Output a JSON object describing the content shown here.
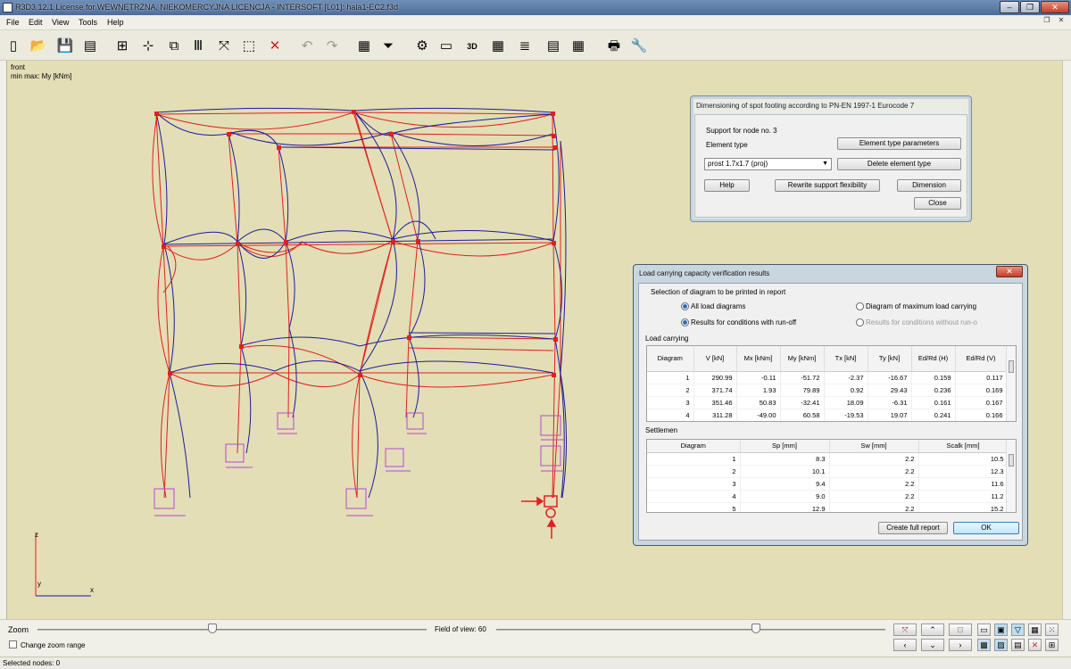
{
  "window": {
    "title": "R3D3 12.1 License for WEWNĘTRZNA, NIEKOMERCYJNA LICENCJA - INTERSOFT [L01]: hala1-EC2.f3d",
    "minimize": "–",
    "maximize": "❐",
    "close": "✕"
  },
  "menu": {
    "items": [
      "File",
      "Edit",
      "View",
      "Tools",
      "Help"
    ]
  },
  "toolbar": {
    "icons": [
      "new-file",
      "open-folder",
      "save",
      "export",
      "frame",
      "node-add",
      "node-move",
      "bars",
      "release",
      "select-area",
      "delete",
      "undo",
      "redo",
      "table",
      "filter",
      "settings-load",
      "view-mode",
      "3d-view",
      "grid",
      "layers",
      "report",
      "calculator",
      "print",
      "tools",
      "help-pointer"
    ],
    "glyphs": [
      "▯",
      "📂",
      "💾",
      "▤",
      "⊞",
      "⊹",
      "⧉",
      "Ⅲ",
      "⤧",
      "⬚",
      "✕",
      "↶",
      "↷",
      "▦",
      "⏷",
      "⚙",
      "▭",
      "3D",
      "▦",
      "≣",
      "▤",
      "▦",
      "🖶",
      "🔧",
      "?"
    ]
  },
  "viewport": {
    "view_name": "front",
    "scale_label": "min max: My [kNm]",
    "axis_z": "z",
    "axis_y": "y",
    "axis_x": "x"
  },
  "footing_dialog": {
    "title": "Dimensioning of spot footing according to PN-EN 1997-1 Eurocode 7",
    "support_label": "Support for node no. 3",
    "element_type_label": "Element type",
    "element_type_value": "prost 1.7x1.7 (proj)",
    "btn_element_type_params": "Element type parameters",
    "btn_delete_element_type": "Delete element type",
    "btn_help": "Help",
    "btn_rewrite": "Rewrite support flexibility",
    "btn_dimension": "Dimension",
    "btn_close": "Close"
  },
  "results_dialog": {
    "title": "Load carrying capacity verification results",
    "close": "✕",
    "selection_label": "Selection of diagram to be printed in report",
    "opt_all": "All load diagrams",
    "opt_max": "Diagram of maximum load carrying",
    "opt_runoff": "Results for conditions with run-off",
    "opt_norunoff": "Results for conditions without run-o",
    "load_section": "Load carrying",
    "load_headers": [
      "Diagram",
      "V [kN]",
      "Mx [kNm]",
      "My [kNm]",
      "Tx [kN]",
      "Ty [kN]",
      "Ed/Rd (H)",
      "Ed/Rd (V)"
    ],
    "load_rows": [
      [
        "1",
        "290.99",
        "-0.11",
        "-51.72",
        "-2.37",
        "-16.67",
        "0.159",
        "0.117"
      ],
      [
        "2",
        "371.74",
        "1.93",
        "79.89",
        "0.92",
        "29.43",
        "0.236",
        "0.169"
      ],
      [
        "3",
        "351.46",
        "50.83",
        "-32.41",
        "18.09",
        "-6.31",
        "0.161",
        "0.167"
      ],
      [
        "4",
        "311.28",
        "-49.00",
        "60.58",
        "-19.53",
        "19.07",
        "0.241",
        "0.166"
      ]
    ],
    "settle_section": "Settlemen",
    "settle_headers": [
      "Diagram",
      "Sp [mm]",
      "Sw [mm]",
      "Scalk [mm]"
    ],
    "settle_rows": [
      [
        "1",
        "8.3",
        "2.2",
        "10.5"
      ],
      [
        "2",
        "10.1",
        "2.2",
        "12.3"
      ],
      [
        "3",
        "9.4",
        "2.2",
        "11.6"
      ],
      [
        "4",
        "9.0",
        "2.2",
        "11.2"
      ],
      [
        "5",
        "12.9",
        "2.2",
        "15.2"
      ]
    ],
    "btn_report": "Create full report",
    "btn_ok": "OK"
  },
  "bottom": {
    "zoom_label": "Zoom",
    "fov_label": "Field of view: 60",
    "change_zoom": "Change zoom range"
  },
  "status": {
    "selected": "Selected nodes: 0"
  },
  "colors": {
    "structure_blue": "#1c1c9c",
    "structure_red": "#e02020",
    "support_magenta": "#b44ad6",
    "viewport_bg": "#e3deb5"
  }
}
